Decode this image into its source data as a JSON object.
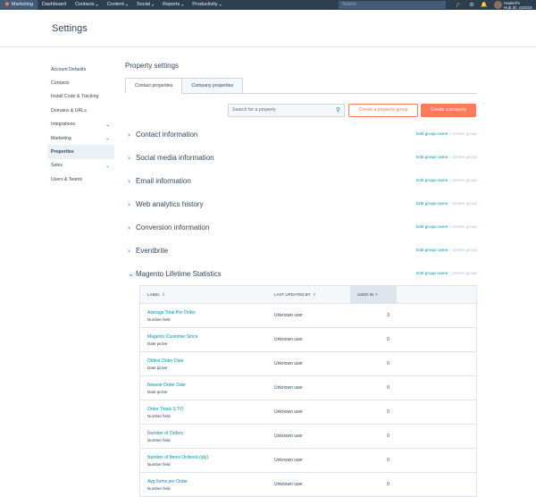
{
  "topnav": {
    "brand": "Marketing",
    "items": [
      {
        "label": "Dashboard",
        "has_menu": false
      },
      {
        "label": "Contacts",
        "has_menu": true
      },
      {
        "label": "Content",
        "has_menu": true
      },
      {
        "label": "Social",
        "has_menu": true
      },
      {
        "label": "Reports",
        "has_menu": true
      },
      {
        "label": "Productivity",
        "has_menu": true
      }
    ],
    "search_placeholder": "Search",
    "account_name": "Haskell's",
    "hub_id": "Hub ID: 410318"
  },
  "header": {
    "title": "Settings"
  },
  "sidebar": {
    "items": [
      {
        "label": "Account Defaults"
      },
      {
        "label": "Contacts"
      },
      {
        "label": "Install Code & Tracking"
      },
      {
        "label": "Domains & URLs"
      },
      {
        "label": "Integrations"
      },
      {
        "label": "Marketing"
      },
      {
        "label": "Properties"
      },
      {
        "label": "Sales"
      },
      {
        "label": "Users & Teams"
      }
    ]
  },
  "main": {
    "title": "Property settings",
    "tabs": [
      {
        "label": "Contact properties",
        "active": true
      },
      {
        "label": "Company properties",
        "active": false
      }
    ],
    "search_placeholder": "Search for a property",
    "create_group_label": "Create a property group",
    "create_property_label": "Create a property",
    "edit_group_label": "Edit group name",
    "delete_group_label": "Delete group",
    "groups": [
      {
        "name": "Contact information",
        "expanded": false
      },
      {
        "name": "Social media information",
        "expanded": false
      },
      {
        "name": "Email information",
        "expanded": false
      },
      {
        "name": "Web analytics history",
        "expanded": false
      },
      {
        "name": "Conversion information",
        "expanded": false
      },
      {
        "name": "Eventbrite",
        "expanded": false
      },
      {
        "name": "Magento Lifetime Statistics",
        "expanded": true
      }
    ],
    "table": {
      "columns": [
        "Label",
        "Last updated by",
        "Used in"
      ],
      "rows": [
        {
          "label": "Average Total Per Order",
          "type": "Number field",
          "updated_by": "Unknown user",
          "used_in": "3"
        },
        {
          "label": "Magento Customer Since",
          "type": "Date picker",
          "updated_by": "Unknown user",
          "used_in": "0"
        },
        {
          "label": "Oldest Order Date",
          "type": "Date picker",
          "updated_by": "Unknown user",
          "used_in": "0"
        },
        {
          "label": "Newest Order Date",
          "type": "Date picker",
          "updated_by": "Unknown user",
          "used_in": "0"
        },
        {
          "label": "Order Totals (LTV)",
          "type": "Number field",
          "updated_by": "Unknown user",
          "used_in": "0"
        },
        {
          "label": "Number of Orders",
          "type": "Number field",
          "updated_by": "Unknown user",
          "used_in": "0"
        },
        {
          "label": "Number of Items Ordered (qty)",
          "type": "Number field",
          "updated_by": "Unknown user",
          "used_in": "0"
        },
        {
          "label": "Avg Items per Order",
          "type": "Number field",
          "updated_by": "Unknown user",
          "used_in": "0"
        }
      ]
    }
  },
  "colors": {
    "nav_bg": "#2d3e50",
    "accent": "#ff7a59",
    "link": "#0091ae",
    "text": "#33475b"
  }
}
